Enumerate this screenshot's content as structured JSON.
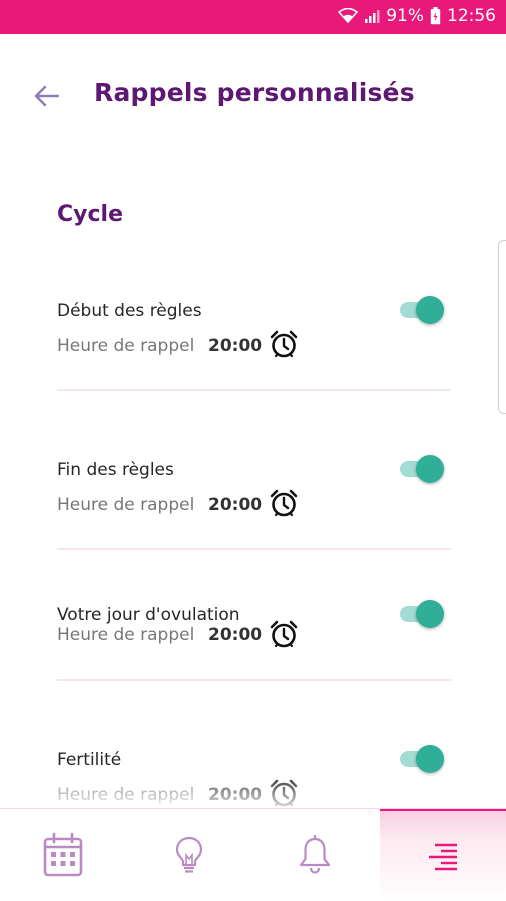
{
  "status_bar": {
    "battery": "91%",
    "time": "12:56"
  },
  "header": {
    "title": "Rappels personnalisés"
  },
  "section": {
    "title": "Cycle"
  },
  "reminders": [
    {
      "label": "Début des règles",
      "time_label": "Heure de rappel",
      "time": "20:00",
      "enabled": true
    },
    {
      "label": "Fin des règles",
      "time_label": "Heure de rappel",
      "time": "20:00",
      "enabled": true
    },
    {
      "label": "Votre jour d'ovulation",
      "time_label": "Heure de rappel",
      "time": "20:00",
      "enabled": true
    },
    {
      "label": "Fertilité",
      "time_label": "Heure de rappel",
      "time": "20:00",
      "enabled": true
    }
  ],
  "bottom_nav": {
    "items": [
      {
        "icon": "calendar-icon",
        "active": false
      },
      {
        "icon": "lightbulb-icon",
        "active": false
      },
      {
        "icon": "bell-icon",
        "active": false
      },
      {
        "icon": "menu-icon",
        "active": true
      }
    ]
  },
  "colors": {
    "status_bar": "#e8197a",
    "title": "#5e1873",
    "toggle_on": "#2fae98",
    "icon_purple": "#b98bc5",
    "accent_pink": "#e8197a"
  }
}
